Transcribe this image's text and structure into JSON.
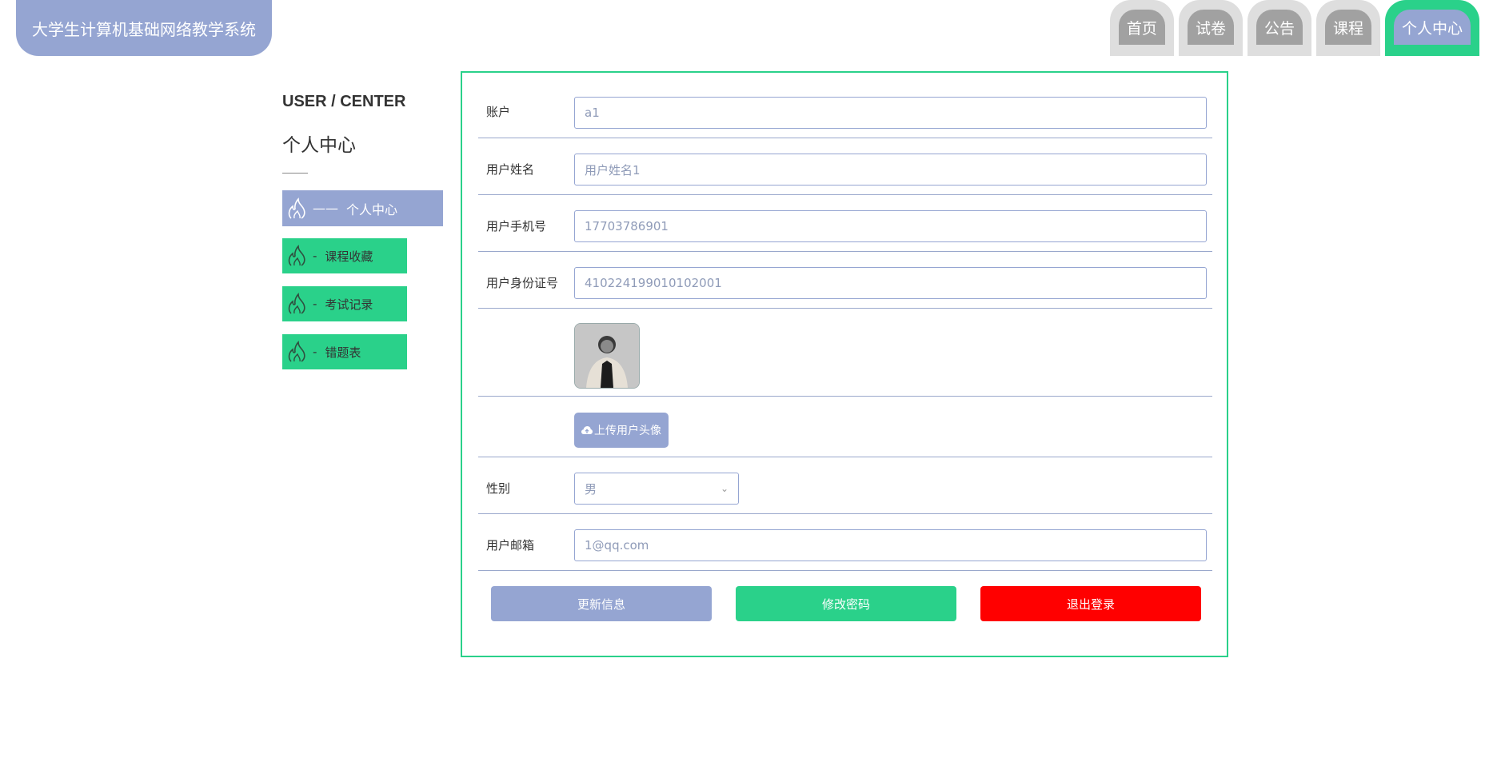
{
  "header": {
    "brand": "大学生计算机基础网络教学系统",
    "nav": [
      "首页",
      "试卷",
      "公告",
      "课程",
      "个人中心"
    ],
    "active_nav": "个人中心",
    "colors": {
      "accent": "#95a5d2",
      "green": "#2ad18a",
      "tab_gray": "#a1a1a1",
      "danger": "#ff0000"
    }
  },
  "sidebar": {
    "title_en": "USER / CENTER",
    "title_cn": "个人中心",
    "items": [
      {
        "label": "个人中心",
        "dash": "——",
        "active": true
      },
      {
        "label": "课程收藏",
        "dash": "-",
        "active": false
      },
      {
        "label": "考试记录",
        "dash": "-",
        "active": false
      },
      {
        "label": "错题表",
        "dash": "-",
        "active": false
      }
    ]
  },
  "form": {
    "account": {
      "label": "账户",
      "value": "a1"
    },
    "name": {
      "label": "用户姓名",
      "value": "用户姓名1"
    },
    "phone": {
      "label": "用户手机号",
      "value": "17703786901"
    },
    "idcard": {
      "label": "用户身份证号",
      "value": "410224199010102001"
    },
    "upload_label": "上传用户头像",
    "gender": {
      "label": "性别",
      "value": "男"
    },
    "email": {
      "label": "用户邮箱",
      "value": "1@qq.com"
    }
  },
  "actions": {
    "update": "更新信息",
    "change_password": "修改密码",
    "logout": "退出登录"
  }
}
